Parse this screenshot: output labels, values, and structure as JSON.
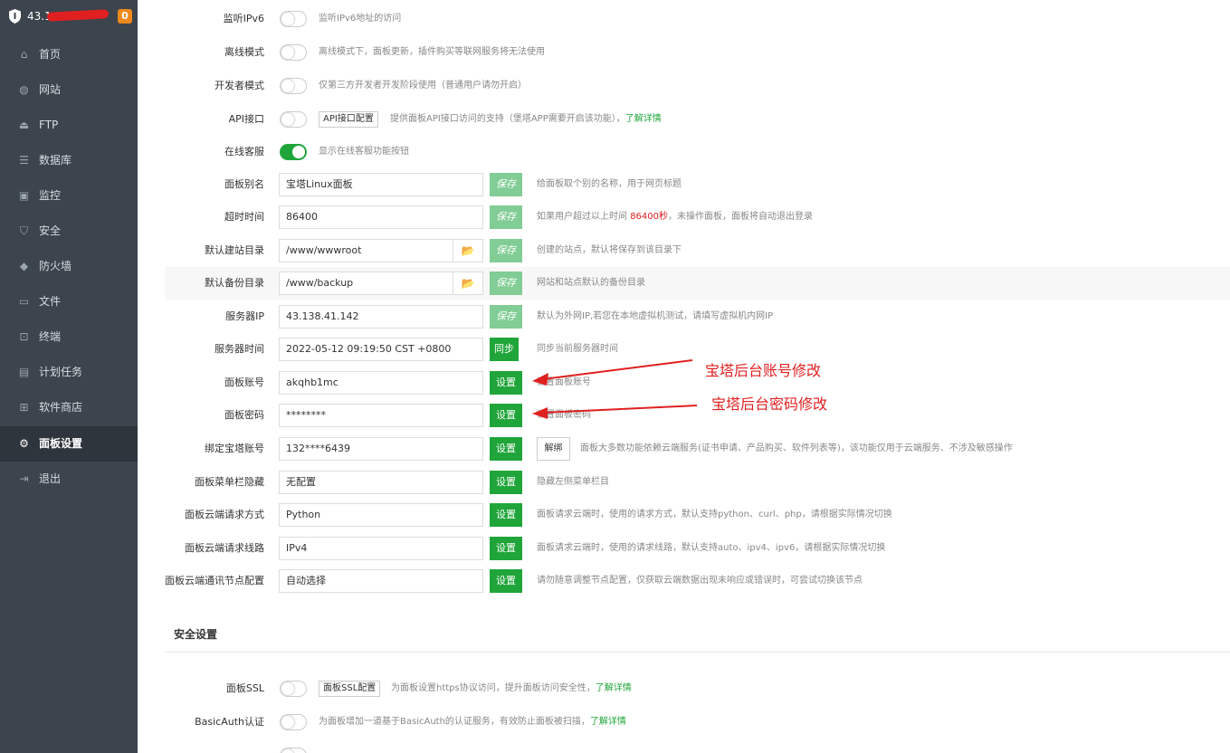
{
  "sidebar": {
    "server_ip": "43.1",
    "badge": "0",
    "items": [
      {
        "label": "首页",
        "icon": "home-icon"
      },
      {
        "label": "网站",
        "icon": "globe-icon"
      },
      {
        "label": "FTP",
        "icon": "ftp-icon"
      },
      {
        "label": "数据库",
        "icon": "database-icon"
      },
      {
        "label": "监控",
        "icon": "monitor-icon"
      },
      {
        "label": "安全",
        "icon": "shield-check-icon"
      },
      {
        "label": "防火墙",
        "icon": "firewall-icon"
      },
      {
        "label": "文件",
        "icon": "folder-icon"
      },
      {
        "label": "终端",
        "icon": "terminal-icon"
      },
      {
        "label": "计划任务",
        "icon": "calendar-icon"
      },
      {
        "label": "软件商店",
        "icon": "apps-icon"
      },
      {
        "label": "面板设置",
        "icon": "gear-icon"
      },
      {
        "label": "退出",
        "icon": "logout-icon"
      }
    ],
    "active_index": 11
  },
  "settings": {
    "ipv6": {
      "label": "监听IPv6",
      "desc": "监听IPv6地址的访问",
      "on": false
    },
    "offline": {
      "label": "离线模式",
      "desc": "离线模式下，面板更新，插件购买等联网服务将无法使用",
      "on": false
    },
    "developer": {
      "label": "开发者模式",
      "desc": "仅第三方开发者开发阶段使用（普通用户请勿开启）",
      "on": false
    },
    "api": {
      "label": "API接口",
      "button": "API接口配置",
      "desc": "提供面板API接口访问的支持（堡塔APP需要开启该功能），",
      "link": "了解详情",
      "on": false
    },
    "online_service": {
      "label": "在线客服",
      "desc": "显示在线客服功能按钮",
      "on": true
    },
    "panel_alias": {
      "label": "面板别名",
      "value": "宝塔Linux面板",
      "button": "保存",
      "desc": "给面板取个别的名称，用于网页标题"
    },
    "timeout": {
      "label": "超时时间",
      "value": "86400",
      "button": "保存",
      "desc_pre": "如果用户超过以上时间 ",
      "desc_hl": "86400秒",
      "desc_post": "，未操作面板，面板将自动退出登录"
    },
    "site_dir": {
      "label": "默认建站目录",
      "value": "/www/wwwroot",
      "folder_icon": "folder-open-icon",
      "button": "保存",
      "desc": "创建的站点，默认将保存到该目录下"
    },
    "backup_dir": {
      "label": "默认备份目录",
      "value": "/www/backup",
      "folder_icon": "folder-open-icon",
      "button": "保存",
      "desc": "网站和站点默认的备份目录"
    },
    "server_ip": {
      "label": "服务器IP",
      "value": "43.138.41.142",
      "button": "保存",
      "desc": "默认为外网IP,若您在本地虚拟机测试，请填写虚拟机内网IP"
    },
    "server_time": {
      "label": "服务器时间",
      "value": "2022-05-12 09:19:50 CST +0800",
      "button": "同步",
      "desc": "同步当前服务器时间"
    },
    "account": {
      "label": "面板账号",
      "value": "akqhb1mc",
      "button": "设置",
      "desc": "设置面板账号"
    },
    "password": {
      "label": "面板密码",
      "value": "********",
      "button": "设置",
      "desc": "设置面板密码"
    },
    "bind_account": {
      "label": "绑定宝塔账号",
      "value": "132****6439",
      "button": "设置",
      "button2": "解绑",
      "desc": "面板大多数功能依赖云端服务(证书申请、产品购买、软件列表等)，该功能仅用于云端服务、不涉及敏感操作"
    },
    "menu_hide": {
      "label": "面板菜单栏隐藏",
      "value": "无配置",
      "button": "设置",
      "desc": "隐藏左侧菜单栏目"
    },
    "request_method": {
      "label": "面板云端请求方式",
      "value": "Python",
      "button": "设置",
      "desc": "面板请求云端时，使用的请求方式，默认支持python、curl、php，请根据实际情况切换"
    },
    "request_line": {
      "label": "面板云端请求线路",
      "value": "IPv4",
      "button": "设置",
      "desc": "面板请求云端时，使用的请求线路，默认支持auto、ipv4、ipv6，请根据实际情况切换"
    },
    "node_config": {
      "label": "面板云端通讯节点配置",
      "value": "自动选择",
      "button": "设置",
      "desc": "请勿随意调整节点配置，仅获取云端数据出现未响应或错误时，可尝试切换该节点"
    }
  },
  "security": {
    "title": "安全设置",
    "ssl": {
      "label": "面板SSL",
      "button": "面板SSL配置",
      "desc": "为面板设置https协议访问，提升面板访问安全性，",
      "link": "了解详情",
      "on": false
    },
    "basic_auth": {
      "label": "BasicAuth认证",
      "desc": "为面板增加一道基于BasicAuth的认证服务，有效防止面板被扫描，",
      "link": "了解详情",
      "on": false
    }
  },
  "annotations": {
    "account": "宝塔后台账号修改",
    "password": "宝塔后台密码修改",
    "color": "#e02020"
  },
  "colors": {
    "accent": "#20a53a",
    "sidebar": "#3c444d",
    "badge": "#f0891c"
  }
}
